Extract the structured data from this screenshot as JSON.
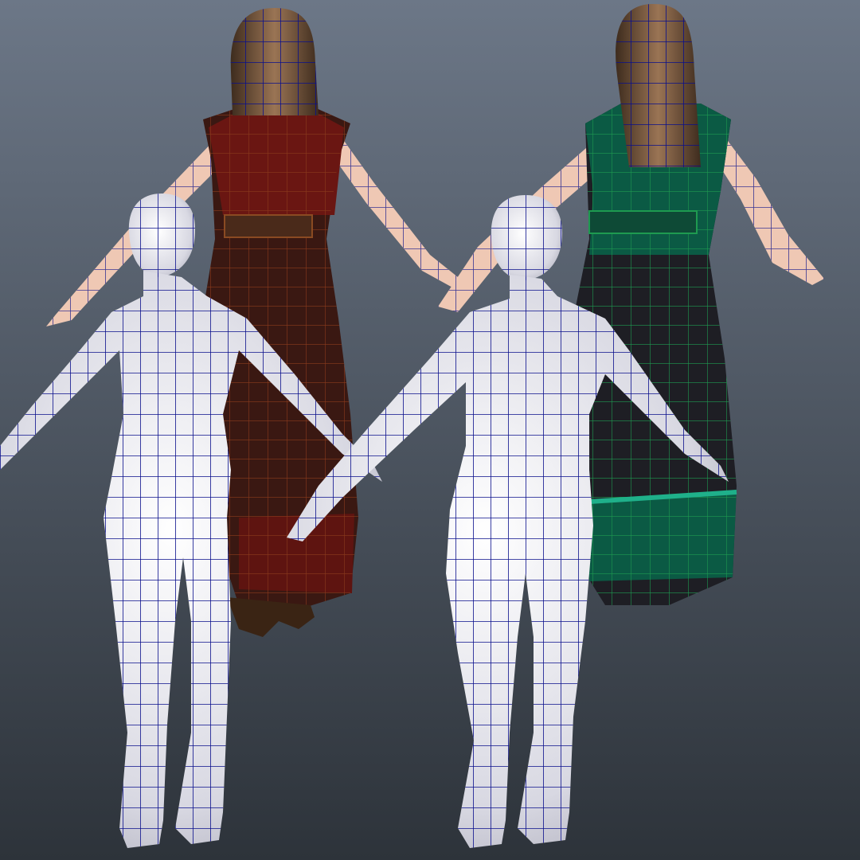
{
  "viewport": {
    "background_top": "#6c7787",
    "background_bottom": "#2d333a",
    "wireframe_color": "#0a0f8c",
    "figures": [
      {
        "name": "dressed-female-red",
        "dress_color": "#5e1410",
        "hair_color": "#6b5038",
        "skin_color": "#efc8b4",
        "wire_color": "#7a3418"
      },
      {
        "name": "dressed-female-green",
        "dress_color": "#0b5a44",
        "hair_color": "#6b5038",
        "skin_color": "#efc8b4",
        "wire_color": "#168a4a"
      },
      {
        "name": "base-body-left",
        "skin_color": "#e6e6ee"
      },
      {
        "name": "base-body-right",
        "skin_color": "#e6e6ee"
      }
    ]
  }
}
